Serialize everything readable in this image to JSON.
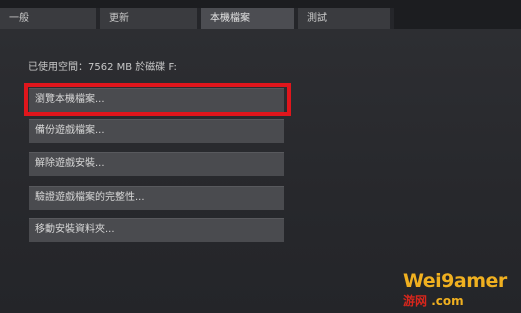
{
  "tabs": [
    {
      "label": "一般",
      "active": false
    },
    {
      "label": "更新",
      "active": false
    },
    {
      "label": "本機檔案",
      "active": true
    },
    {
      "label": "測試",
      "active": false
    }
  ],
  "disk_info": "已使用空間：7562 MB 於磁碟 F:",
  "buttons": {
    "browse": "瀏覽本機檔案...",
    "backup": "備份遊戲檔案...",
    "uninstall": "解除遊戲安裝...",
    "verify": "驗證遊戲檔案的完整性...",
    "move": "移動安裝資料夾..."
  },
  "watermark": {
    "main": "Wei9amer",
    "sub_cn": "游网",
    "sub_com": ".com"
  },
  "colors": {
    "highlight": "#e0161c",
    "background": "#25262a",
    "button": "#4a4b4f",
    "logo_gold": "#f0b020",
    "logo_red": "#d8261c"
  }
}
